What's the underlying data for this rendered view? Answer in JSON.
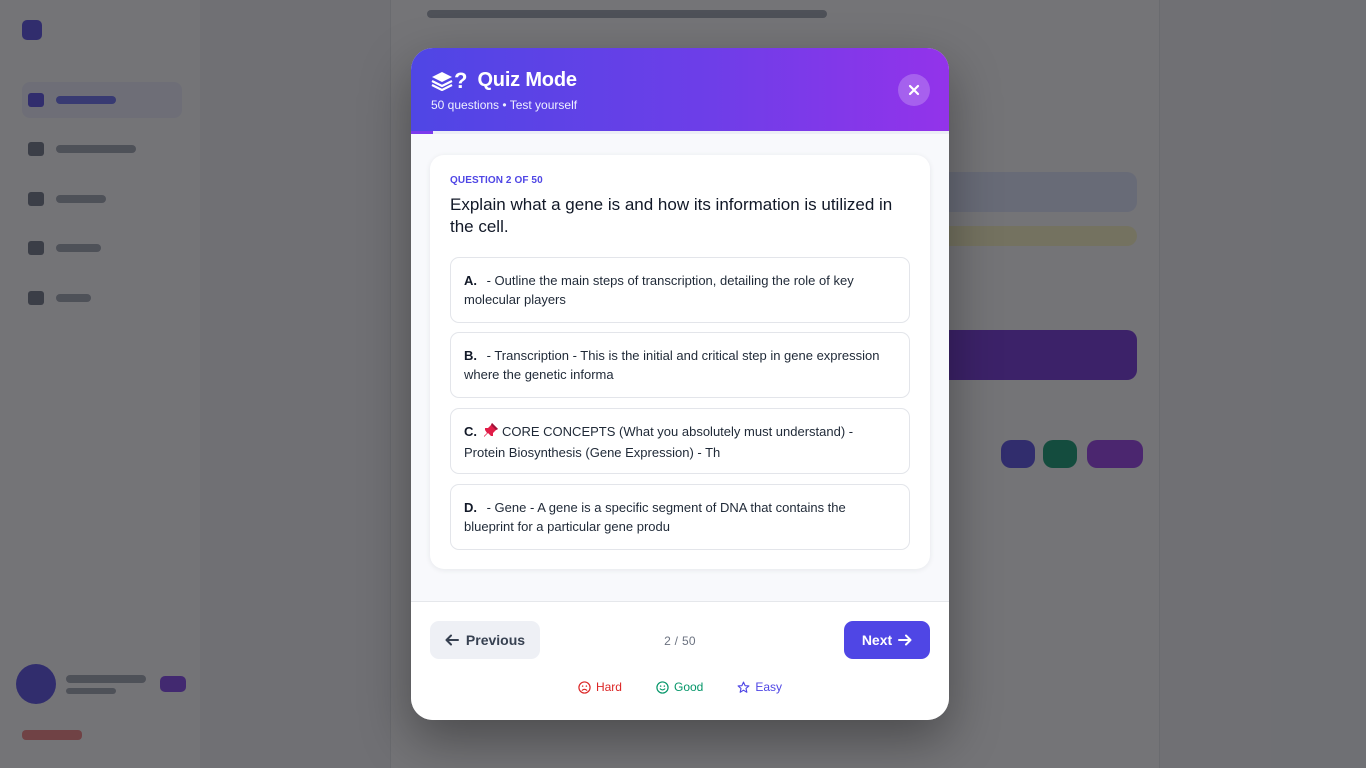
{
  "modal": {
    "title": "Quiz Mode",
    "subtitle": "50 questions • Test yourself",
    "progress": 0.04,
    "question": {
      "counter": "QUESTION 2 OF 50",
      "text": "Explain what a gene is and how its information is utilized in the cell."
    },
    "options": [
      {
        "letter": "A.",
        "text": " - Outline the main steps of transcription, detailing the role of key molecular players"
      },
      {
        "letter": "B.",
        "text": " - Transcription - This is the initial and critical step in gene expression where the genetic informa"
      },
      {
        "letter": "C.",
        "text": "CORE CONCEPTS (What you absolutely must understand) - Protein Biosynthesis (Gene Expression) - Th",
        "icon": "pushpin-icon"
      },
      {
        "letter": "D.",
        "text": " - Gene - A gene is a specific segment of DNA that contains the blueprint for a particular gene produ"
      }
    ],
    "footer": {
      "previous_label": "Previous",
      "page_indicator": "2 / 50",
      "next_label": "Next",
      "ratings": {
        "hard": "Hard",
        "good": "Good",
        "easy": "Easy"
      }
    }
  },
  "colors": {
    "accent": "#4f46e5",
    "header_gradient_end": "#9333ea",
    "hard": "#dc2626",
    "good": "#059669",
    "easy": "#4f46e5"
  }
}
